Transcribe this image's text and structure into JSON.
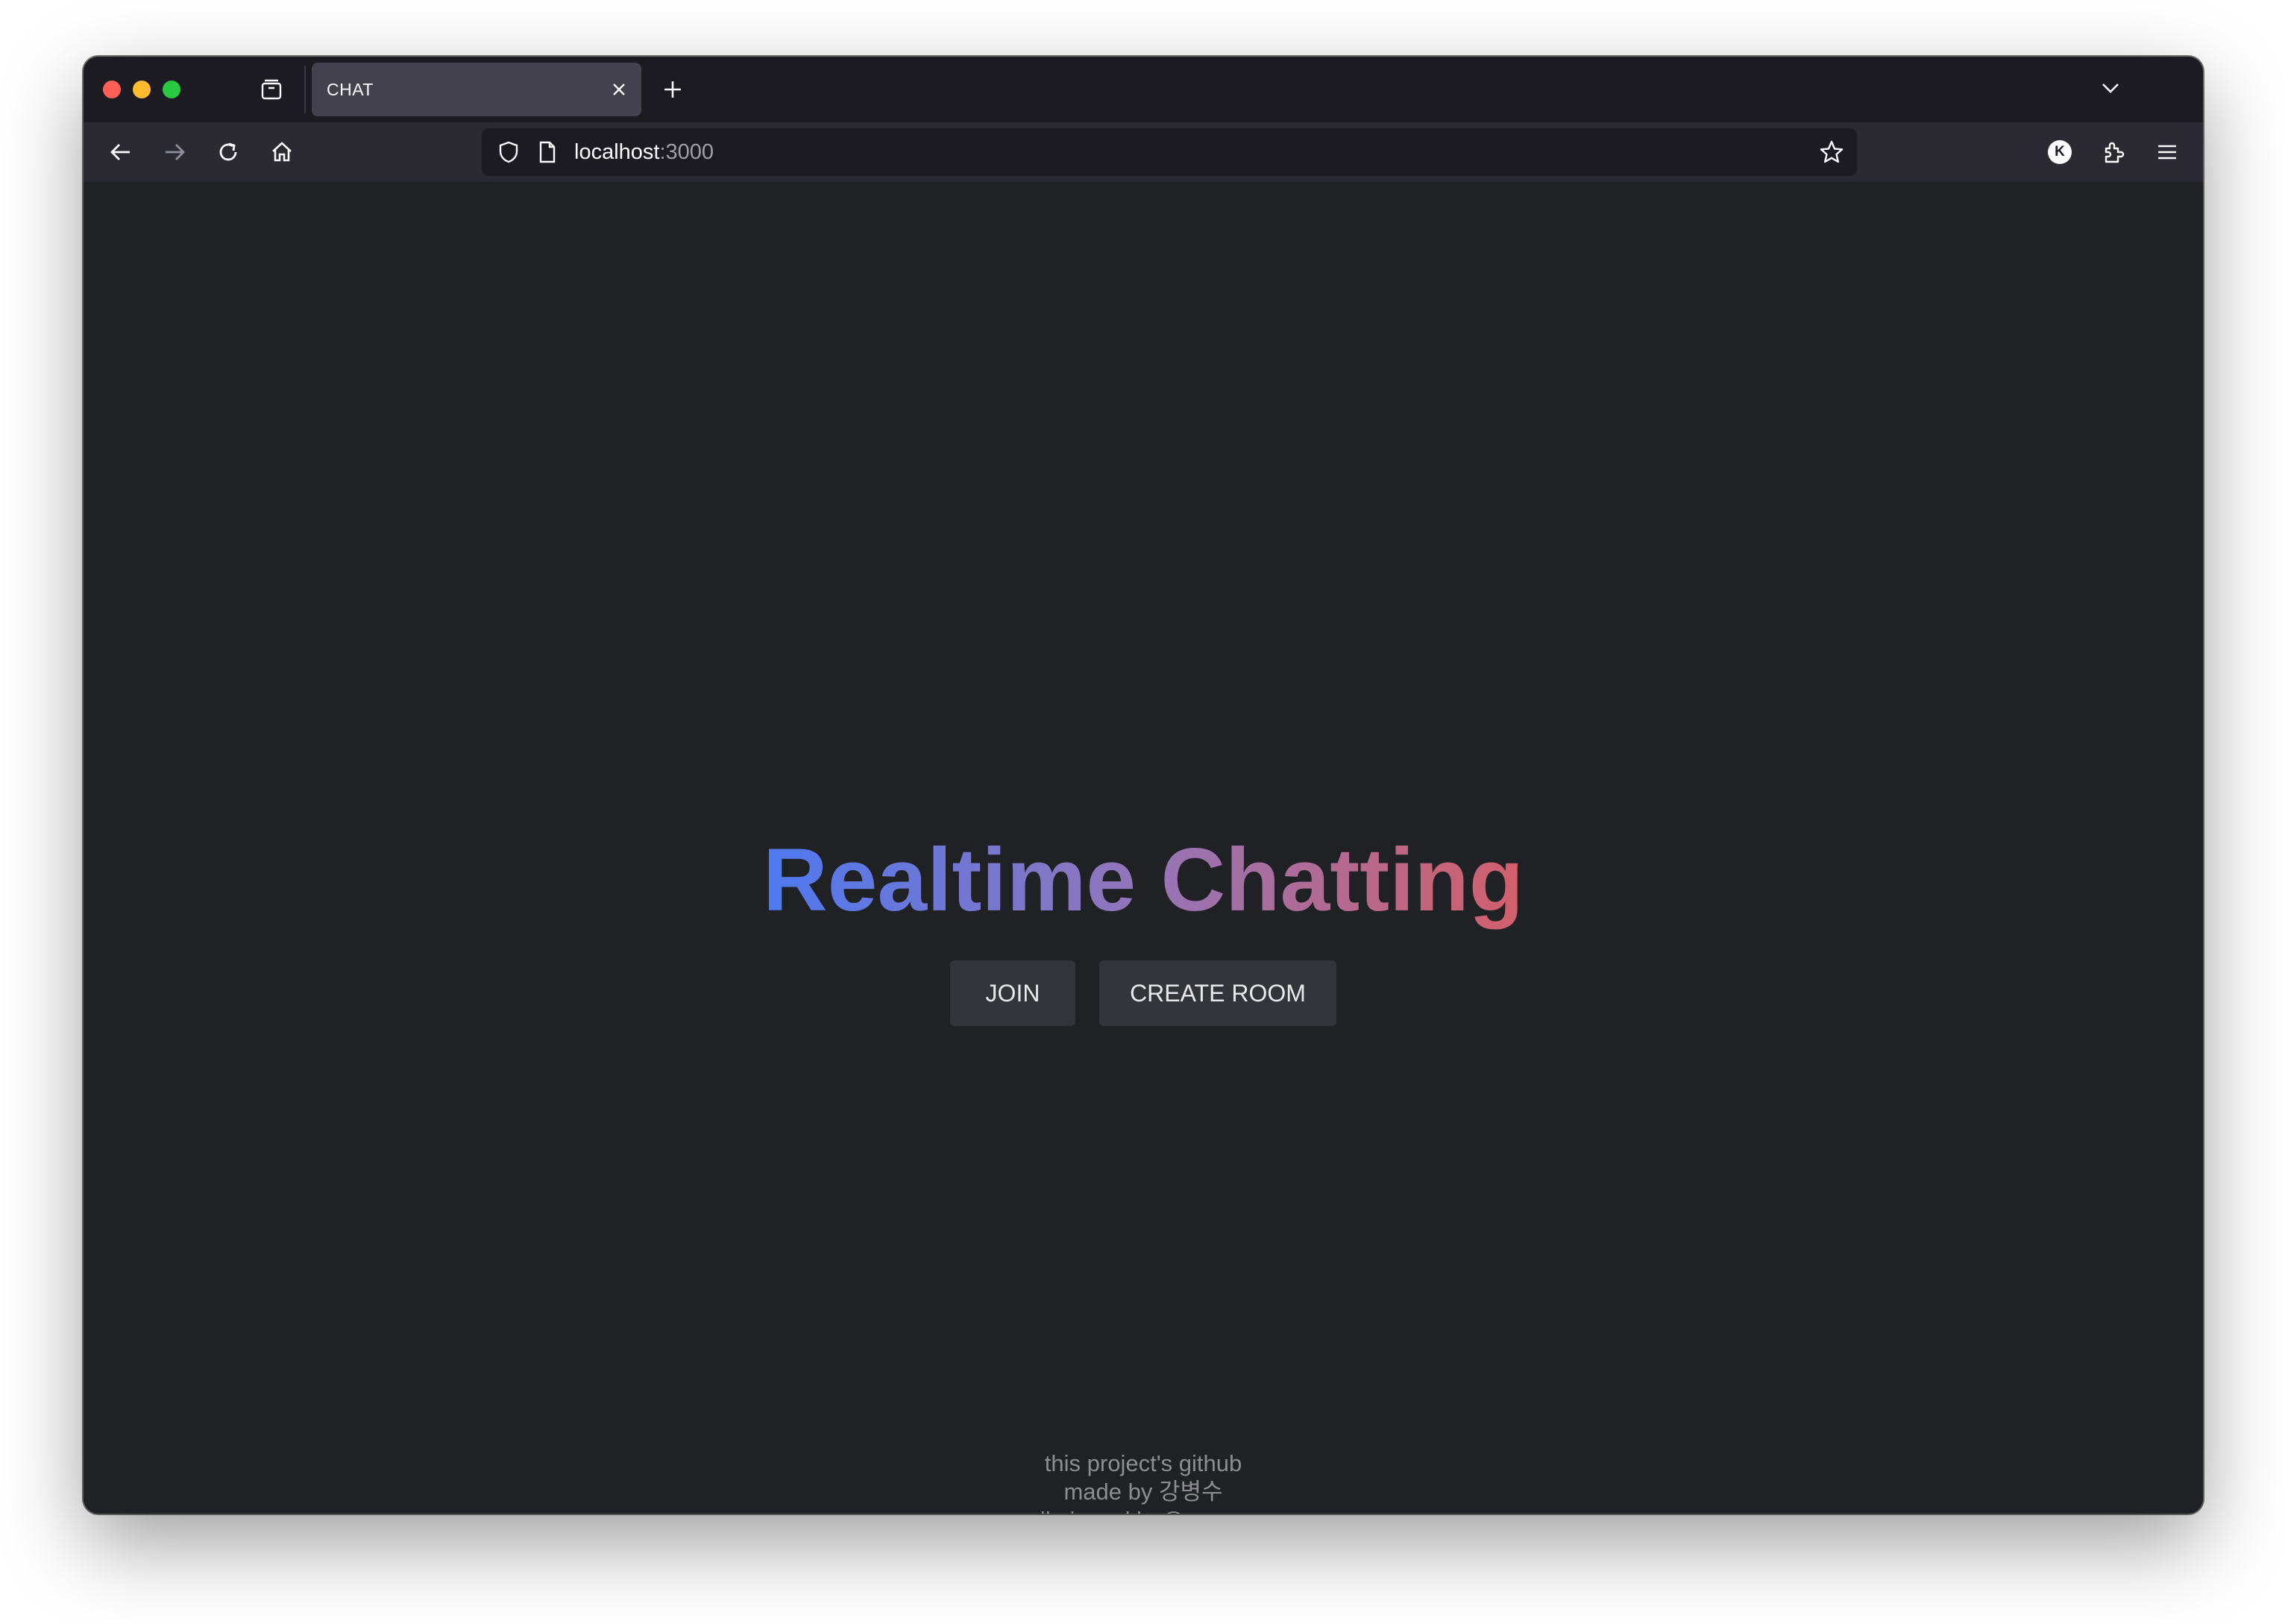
{
  "browser": {
    "tab": {
      "title": "CHAT"
    },
    "url": {
      "host": "localhost",
      "port": ":3000"
    },
    "profile_initial": "K"
  },
  "page": {
    "title": "Realtime Chatting",
    "buttons": {
      "join": "JOIN",
      "create_room": "CREATE ROOM"
    },
    "footer": {
      "github": "this project's github",
      "made_by": "made by 강병수",
      "email": "email : jasonkbs@naver.com"
    }
  },
  "colors": {
    "background": "#202125",
    "title_gradient": [
      "#4d79f0",
      "#9475b8",
      "#d25f6a"
    ],
    "button_bg": "#34353a",
    "footer_text": "#8c8c92"
  },
  "icons": [
    "tab-overview-icon",
    "close-icon",
    "new-tab-icon",
    "tab-list-chevron-icon",
    "back-icon",
    "forward-icon",
    "reload-icon",
    "home-icon",
    "shield-icon",
    "page-icon",
    "bookmark-star-icon",
    "extensions-icon",
    "menu-icon"
  ]
}
